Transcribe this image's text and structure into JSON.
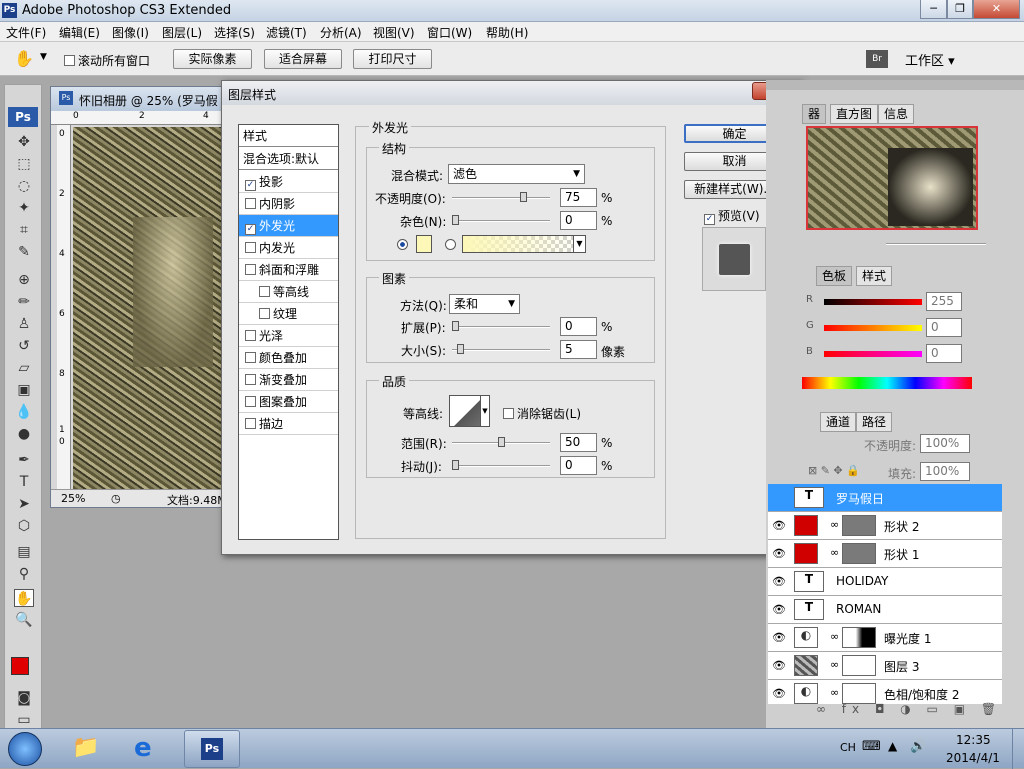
{
  "app": {
    "title": "Adobe Photoshop CS3 Extended",
    "ps_icon": "Ps",
    "win_min": "─",
    "win_max": "❐",
    "win_close": "✕"
  },
  "menu": [
    "文件(F)",
    "编辑(E)",
    "图像(I)",
    "图层(L)",
    "选择(S)",
    "滤镜(T)",
    "分析(A)",
    "视图(V)",
    "窗口(W)",
    "帮助(H)"
  ],
  "options": {
    "scroll_all": "滚动所有窗口",
    "actual_pixels": "实际像素",
    "fit_screen": "适合屏幕",
    "print_size": "打印尺寸",
    "workspace": "工作区 ▾",
    "bridge": "Br"
  },
  "document": {
    "title": "怀旧相册 @ 25% (罗马假",
    "zoom": "25%",
    "status": "文档:9.48M",
    "ruler_top": [
      "0",
      "2",
      "4"
    ],
    "ruler_left": [
      "0",
      "2",
      "4",
      "6",
      "8",
      "1",
      "0"
    ]
  },
  "dialog": {
    "title": "图层样式",
    "close": "✕",
    "styles_header": "样式",
    "blend_options": "混合选项:默认",
    "items": [
      {
        "label": "投影",
        "checked": true,
        "indent": false
      },
      {
        "label": "内阴影",
        "checked": false,
        "indent": false
      },
      {
        "label": "外发光",
        "checked": true,
        "indent": false,
        "selected": true
      },
      {
        "label": "内发光",
        "checked": false,
        "indent": false
      },
      {
        "label": "斜面和浮雕",
        "checked": false,
        "indent": false
      },
      {
        "label": "等高线",
        "checked": false,
        "indent": true
      },
      {
        "label": "纹理",
        "checked": false,
        "indent": true
      },
      {
        "label": "光泽",
        "checked": false,
        "indent": false
      },
      {
        "label": "颜色叠加",
        "checked": false,
        "indent": false
      },
      {
        "label": "渐变叠加",
        "checked": false,
        "indent": false
      },
      {
        "label": "图案叠加",
        "checked": false,
        "indent": false
      },
      {
        "label": "描边",
        "checked": false,
        "indent": false
      }
    ],
    "section_title": "外发光",
    "structure": {
      "title": "结构",
      "blend_mode_label": "混合模式:",
      "blend_mode": "滤色",
      "opacity_label": "不透明度(O):",
      "opacity": "75",
      "noise_label": "杂色(N):",
      "noise": "0",
      "percent": "%",
      "opacity_pos": 0.75,
      "noise_pos": 0
    },
    "elements": {
      "title": "图素",
      "technique_label": "方法(Q):",
      "technique": "柔和",
      "spread_label": "扩展(P):",
      "spread": "0",
      "size_label": "大小(S):",
      "size": "5",
      "px": "像素",
      "spread_pos": 0,
      "size_pos": 0.05
    },
    "quality": {
      "title": "品质",
      "contour_label": "等高线:",
      "antialias": "消除锯齿(L)",
      "range_label": "范围(R):",
      "range": "50",
      "jitter_label": "抖动(J):",
      "jitter": "0",
      "range_pos": 0.5,
      "jitter_pos": 0
    },
    "buttons": {
      "ok": "确定",
      "cancel": "取消",
      "new_style": "新建样式(W)...",
      "preview": "预览(V)"
    },
    "glow_color": "#fdf8b8"
  },
  "panels": {
    "nav_tabs": [
      "器",
      "直方图",
      "信息"
    ],
    "color_tabs": [
      "色板",
      "样式"
    ],
    "rgb": [
      {
        "ch": "R",
        "val": "255"
      },
      {
        "ch": "G",
        "val": "0"
      },
      {
        "ch": "B",
        "val": "0"
      }
    ],
    "layer_tabs": [
      "通道",
      "路径"
    ],
    "opacity_label": "不透明度:",
    "opacity": "100%",
    "fill_label": "填充:",
    "fill": "100%",
    "layers": [
      {
        "name": "罗马假日",
        "type": "text",
        "selected": true
      },
      {
        "name": "形状 2",
        "type": "shape"
      },
      {
        "name": "形状 1",
        "type": "shape"
      },
      {
        "name": "HOLIDAY",
        "type": "text"
      },
      {
        "name": "ROMAN",
        "type": "text"
      },
      {
        "name": "曝光度 1",
        "type": "adjust"
      },
      {
        "name": "图层 3",
        "type": "image"
      },
      {
        "name": "色相/饱和度 2",
        "type": "adjust"
      }
    ]
  },
  "taskbar": {
    "lang": "CH",
    "time": "12:35",
    "date": "2014/4/1"
  }
}
